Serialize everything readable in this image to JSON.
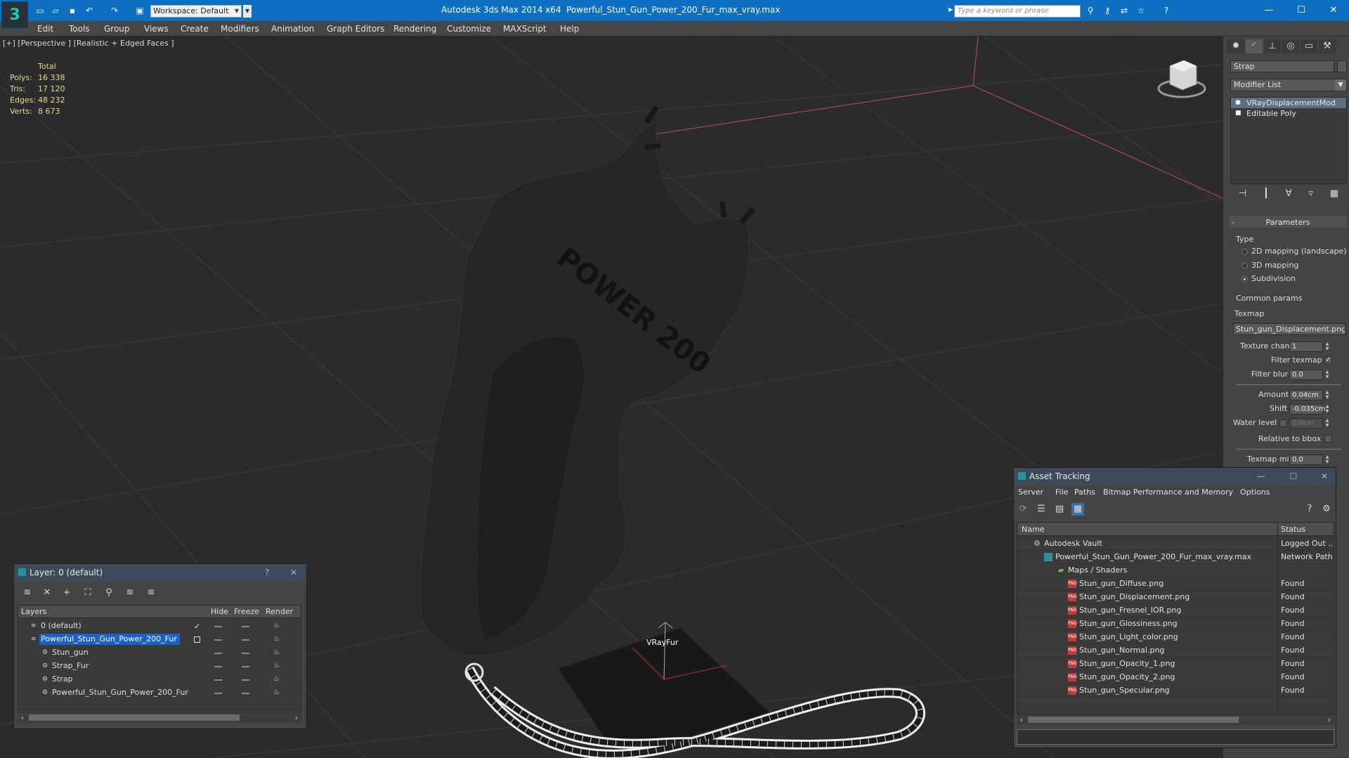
{
  "titlebar": {
    "app_title": "Autodesk 3ds Max  2014 x64",
    "file_title": "Powerful_Stun_Gun_Power_200_Fur_max_vray.max",
    "workspace": "Workspace: Default",
    "search_placeholder": "Type a keyword or phrase",
    "quick_access_icons": [
      "new-icon",
      "open-icon",
      "save-icon",
      "undo-icon",
      "redo-icon",
      "project-icon"
    ],
    "toolbar_icons": [
      "binoculars-icon",
      "key-icon",
      "exchange-icon",
      "favorites-icon",
      "help-icon"
    ],
    "window_controls": {
      "minimize": "—",
      "maximize": "☐",
      "close": "✕"
    }
  },
  "menubar": {
    "items": [
      "Edit",
      "Tools",
      "Group",
      "Views",
      "Create",
      "Modifiers",
      "Animation",
      "Graph Editors",
      "Rendering",
      "Customize",
      "MAXScript",
      "Help"
    ]
  },
  "viewport": {
    "label": "[+] [Perspective ] [Realistic + Edged Faces ]",
    "stats": {
      "header": "Total",
      "rows": [
        {
          "key": "Polys:",
          "value": "16 338"
        },
        {
          "key": "Tris:",
          "value": "17 120"
        },
        {
          "key": "Edges:",
          "value": "48 232"
        },
        {
          "key": "Verts:",
          "value": "8 673"
        }
      ]
    },
    "model_text": "POWER 200",
    "helper_label": "VRayFur",
    "colors": {
      "background": "#2b2b2b",
      "grid": "#3a3a3a",
      "stats_text": "#e9d98a",
      "model": "#262626",
      "selection_line": "#d04a6a"
    }
  },
  "command_panel": {
    "tabs": [
      "create-icon",
      "modify-icon",
      "hierarchy-icon",
      "motion-icon",
      "display-icon",
      "utilities-icon"
    ],
    "object_name": "Strap",
    "modifier_list": "Modifier List",
    "stack": [
      {
        "label": "VRayDisplacementMod",
        "selected": true
      },
      {
        "label": "Editable Poly",
        "selected": false
      }
    ],
    "stack_tools": [
      "pin-stack-icon",
      "show-end-result-icon",
      "make-unique-icon",
      "remove-modifier-icon",
      "configure-sets-icon"
    ],
    "parameters": {
      "rollout_title": "Parameters",
      "type_label": "Type",
      "type_options": [
        {
          "label": "2D mapping (landscape)",
          "checked": false
        },
        {
          "label": "3D mapping",
          "checked": false
        },
        {
          "label": "Subdivision",
          "checked": true
        }
      ],
      "common_params_label": "Common params",
      "texmap_label": "Texmap",
      "texmap_value": "Stun_gun_Displacement.png)",
      "texture_chan_label": "Texture chan",
      "texture_chan_value": "1",
      "filter_texmap_label": "Filter texmap",
      "filter_texmap_checked": true,
      "filter_blur_label": "Filter blur",
      "filter_blur_value": "0.0",
      "amount_label": "Amount",
      "amount_value": "0.04cm",
      "shift_label": "Shift",
      "shift_value": "-0.035cm",
      "water_level_label": "Water level",
      "water_level_value": "0.0cm",
      "relative_bbox_label": "Relative to bbox",
      "texmap_min_label": "Texmap min",
      "texmap_min_value": "0.0"
    }
  },
  "layer_dialog": {
    "title": "Layer: 0 (default)",
    "help": "?",
    "close": "✕",
    "tools": [
      "create-layer-icon",
      "delete-layer-icon",
      "add-selection-icon",
      "select-objects-icon",
      "highlight-layer-icon",
      "hide-all-icon",
      "freeze-all-icon"
    ],
    "columns": [
      "Layers",
      "Hide",
      "Freeze",
      "Render"
    ],
    "rows": [
      {
        "name": "0 (default)",
        "kind": "layer",
        "current": true
      },
      {
        "name": "Powerful_Stun_Gun_Power_200_Fur",
        "kind": "layer",
        "selected": true
      },
      {
        "name": "Stun_gun",
        "kind": "object"
      },
      {
        "name": "Strap_Fur",
        "kind": "object"
      },
      {
        "name": "Strap",
        "kind": "object"
      },
      {
        "name": "Powerful_Stun_Gun_Power_200_Fur",
        "kind": "object"
      }
    ]
  },
  "asset_dialog": {
    "title": "Asset Tracking",
    "menu": [
      "Server",
      "File",
      "Paths",
      "Bitmap Performance and Memory",
      "Options"
    ],
    "tools": [
      "refresh-icon",
      "list-view-icon",
      "table-view-icon",
      "grid-view-icon"
    ],
    "right_tools": [
      "help-icon",
      "settings-icon"
    ],
    "columns": [
      "Name",
      "Status"
    ],
    "rows": [
      {
        "name": "Autodesk Vault",
        "status": "Logged Out ...",
        "icon": "vault-icon",
        "indent": 1
      },
      {
        "name": "Powerful_Stun_Gun_Power_200_Fur_max_vray.max",
        "status": "Network Path",
        "icon": "max-file-icon",
        "indent": 2
      },
      {
        "name": "Maps / Shaders",
        "status": "",
        "icon": "maps-icon",
        "indent": 3
      },
      {
        "name": "Stun_gun_Diffuse.png",
        "status": "Found",
        "icon": "png-icon",
        "indent": 4
      },
      {
        "name": "Stun_gun_Displacement.png",
        "status": "Found",
        "icon": "png-icon",
        "indent": 4
      },
      {
        "name": "Stun_gun_Fresnel_IOR.png",
        "status": "Found",
        "icon": "png-icon",
        "indent": 4
      },
      {
        "name": "Stun_gun_Glossiness.png",
        "status": "Found",
        "icon": "png-icon",
        "indent": 4
      },
      {
        "name": "Stun_gun_Light_color.png",
        "status": "Found",
        "icon": "png-icon",
        "indent": 4
      },
      {
        "name": "Stun_gun_Normal.png",
        "status": "Found",
        "icon": "png-icon",
        "indent": 4
      },
      {
        "name": "Stun_gun_Opacity_1.png",
        "status": "Found",
        "icon": "png-icon",
        "indent": 4
      },
      {
        "name": "Stun_gun_Opacity_2.png",
        "status": "Found",
        "icon": "png-icon",
        "indent": 4
      },
      {
        "name": "Stun_gun_Specular.png",
        "status": "Found",
        "icon": "png-icon",
        "indent": 4
      }
    ]
  }
}
